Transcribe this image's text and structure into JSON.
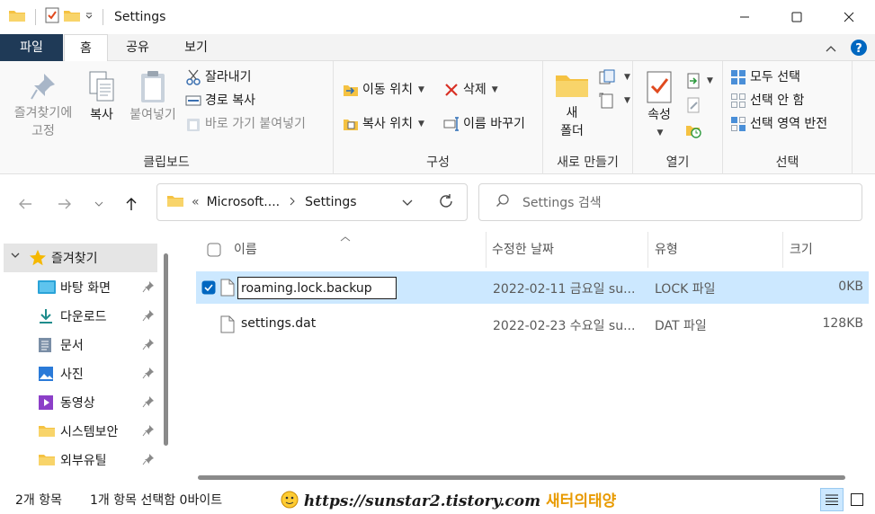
{
  "window": {
    "title": "Settings"
  },
  "ribbon_tabs": {
    "file": "파일",
    "home": "홈",
    "share": "공유",
    "view": "보기"
  },
  "clipboard": {
    "pin_to_quick_access": [
      "즐겨찾기에",
      "고정"
    ],
    "copy": "복사",
    "paste": "붙여넣기",
    "cut": "잘라내기",
    "copy_path": "경로 복사",
    "paste_shortcut": "바로 가기 붙여넣기",
    "group_label": "클립보드"
  },
  "organize": {
    "move_to": "이동 위치",
    "copy_to": "복사 위치",
    "delete": "삭제",
    "rename": "이름 바꾸기",
    "group_label": "구성"
  },
  "new_group": {
    "new_folder": [
      "새",
      "폴더"
    ],
    "group_label": "새로 만들기"
  },
  "open_group": {
    "properties": "속성",
    "group_label": "열기"
  },
  "select_group": {
    "select_all": "모두 선택",
    "select_none": "선택 안 함",
    "invert_selection": "선택 영역 반전",
    "group_label": "선택"
  },
  "address": {
    "overflow": "«",
    "crumbs": [
      "Microsoft....",
      "Settings"
    ],
    "search_placeholder": "Settings 검색"
  },
  "nav_pane": {
    "quick_access": "즐겨찾기",
    "items": [
      {
        "label": "바탕 화면",
        "icon": "desktop-icon"
      },
      {
        "label": "다운로드",
        "icon": "download-icon"
      },
      {
        "label": "문서",
        "icon": "document-icon"
      },
      {
        "label": "사진",
        "icon": "pictures-icon"
      },
      {
        "label": "동영상",
        "icon": "video-icon"
      },
      {
        "label": "시스템보안",
        "icon": "folder-icon"
      },
      {
        "label": "외부유틸",
        "icon": "folder-icon"
      }
    ]
  },
  "columns": {
    "name": "이름",
    "date_modified": "수정한 날짜",
    "type": "유형",
    "size": "크기"
  },
  "files": [
    {
      "name": "roaming.lock.backup",
      "date": "2022-02-11 금요일 su...",
      "type": "LOCK 파일",
      "size": "0KB",
      "selected": true,
      "renaming": true
    },
    {
      "name": "settings.dat",
      "date": "2022-02-23 수요일 su...",
      "type": "DAT 파일",
      "size": "128KB",
      "selected": false,
      "renaming": false
    }
  ],
  "status": {
    "item_count": "2개 항목",
    "selection": "1개 항목 선택함 0바이트",
    "watermark_url": "https://sunstar2.tistory.com",
    "watermark_name": "새터의태양"
  },
  "colors": {
    "file_tab": "#1f3a57",
    "selection": "#cce8ff",
    "accent": "#0067c0",
    "folder": "#f5c242"
  }
}
